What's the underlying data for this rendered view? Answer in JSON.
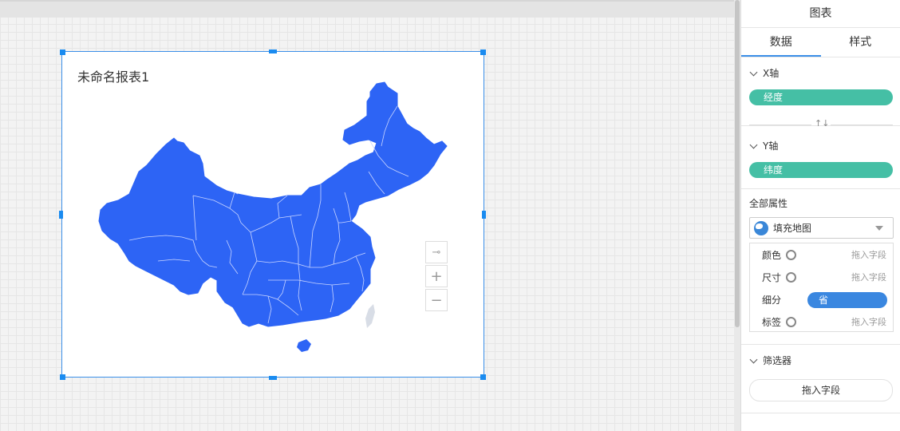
{
  "chart": {
    "title": "未命名报表1",
    "map_fill": "#2d64f5",
    "map_border": "#c9d5ff",
    "controls": [
      {
        "name": "pin-icon",
        "glyph": "⊸"
      },
      {
        "name": "zoom-in-icon",
        "glyph": "+"
      },
      {
        "name": "zoom-out-icon",
        "glyph": "−"
      }
    ]
  },
  "panel": {
    "title": "图表",
    "tabs": [
      {
        "label": "数据",
        "active": true
      },
      {
        "label": "样式",
        "active": false
      }
    ],
    "x_axis": {
      "label": "X轴",
      "field": "经度"
    },
    "swap_glyph": "↑↓",
    "y_axis": {
      "label": "Y轴",
      "field": "纬度"
    },
    "properties": {
      "label": "全部属性",
      "chart_type": "填充地图",
      "rows": [
        {
          "name": "颜色",
          "hint": "拖入字段"
        },
        {
          "name": "尺寸",
          "hint": "拖入字段"
        },
        {
          "name": "细分",
          "field": "省"
        },
        {
          "name": "标签",
          "hint": "拖入字段"
        }
      ]
    },
    "filter": {
      "label": "筛选器",
      "drop_hint": "拖入字段"
    },
    "colors": {
      "pill_green": "#45bfa5",
      "pill_blue": "#3a87e0",
      "accent": "#3b8fe8"
    }
  }
}
